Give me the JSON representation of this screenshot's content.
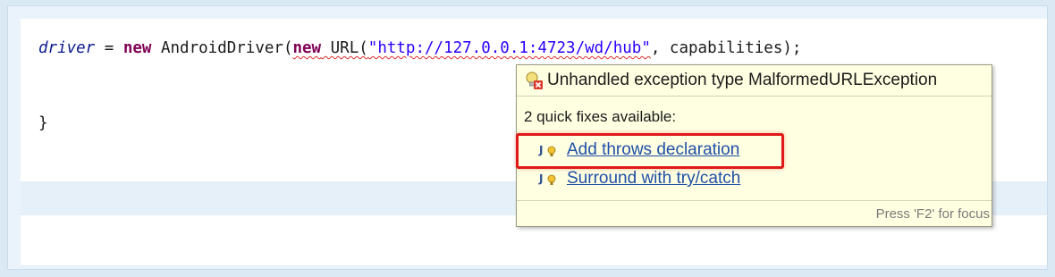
{
  "editor": {
    "line1": {
      "var": "driver",
      "assign": " = ",
      "kw_new": "new",
      "class_call": " AndroidDriver(",
      "err_new": "new",
      "err_url": " URL(",
      "err_string": "\"http://127.0.0.1:4723/wd/hub\"",
      "rest": ", capabilities);"
    },
    "line2": "}"
  },
  "hover": {
    "title": "Unhandled exception type MalformedURLException",
    "fixes_count": "2 quick fixes available:",
    "fixes": [
      {
        "label": "Add throws declaration"
      },
      {
        "label": "Surround with try/catch"
      }
    ],
    "footer": "Press 'F2' for focus"
  },
  "colors": {
    "keyword": "#7f0055",
    "string": "#2a00ff",
    "variable": "#0a1a8c",
    "link": "#1f4fa8",
    "tooltip_bg": "#ffffe1",
    "highlight": "#e01919"
  },
  "icons": {
    "header": "error-lightbulb-icon",
    "fix": "java-quickfix-icon"
  }
}
